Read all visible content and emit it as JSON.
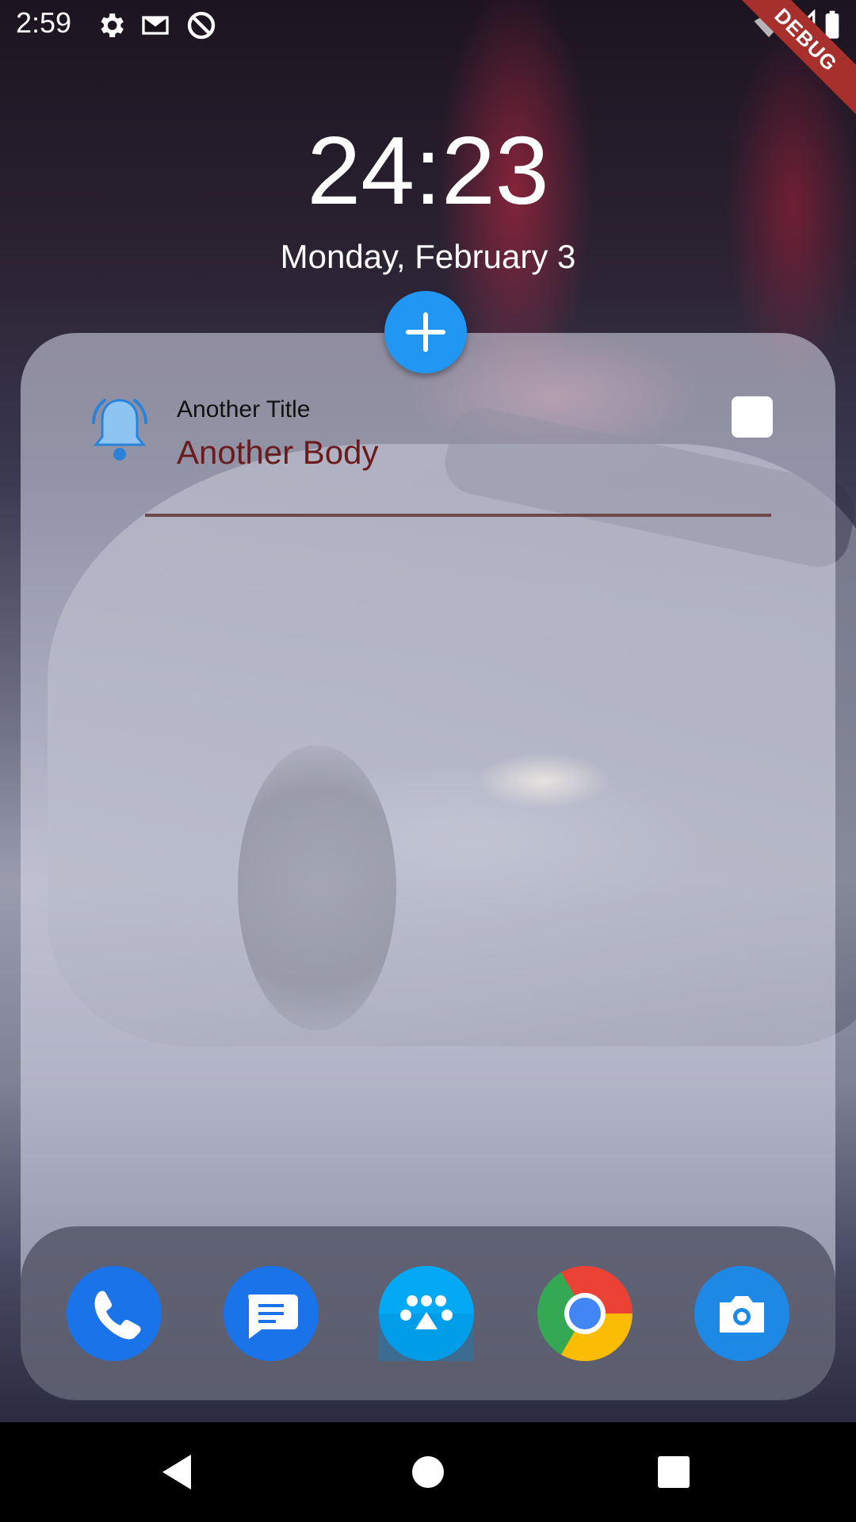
{
  "status_bar": {
    "time": "2:59",
    "left_icons": [
      "settings-icon",
      "gmail-icon",
      "do-not-disturb-icon"
    ],
    "right_icons": [
      "wifi-off-icon",
      "signal-icon",
      "battery-icon"
    ],
    "debug_label": "DEBUG"
  },
  "clock": {
    "time": "24:23",
    "date": "Monday, February 3"
  },
  "add_button": {
    "icon": "plus-icon",
    "color": "#2196f3"
  },
  "notes": [
    {
      "title": "Another Title",
      "body": "Another Body",
      "icon": "bell-icon",
      "checked": false
    }
  ],
  "dock": {
    "apps": [
      {
        "name": "Phone",
        "icon": "phone-icon",
        "color": "#1a73e8"
      },
      {
        "name": "Messages",
        "icon": "messages-icon",
        "color": "#1a73e8"
      },
      {
        "name": "Apps",
        "icon": "apps-dots-icon",
        "color": "#03a9f4"
      },
      {
        "name": "Chrome",
        "icon": "chrome-icon",
        "color": "#ea4335"
      },
      {
        "name": "Camera",
        "icon": "camera-icon",
        "color": "#1e88e5"
      }
    ]
  },
  "navigation": {
    "buttons": [
      "back-icon",
      "home-icon",
      "recents-icon"
    ]
  }
}
